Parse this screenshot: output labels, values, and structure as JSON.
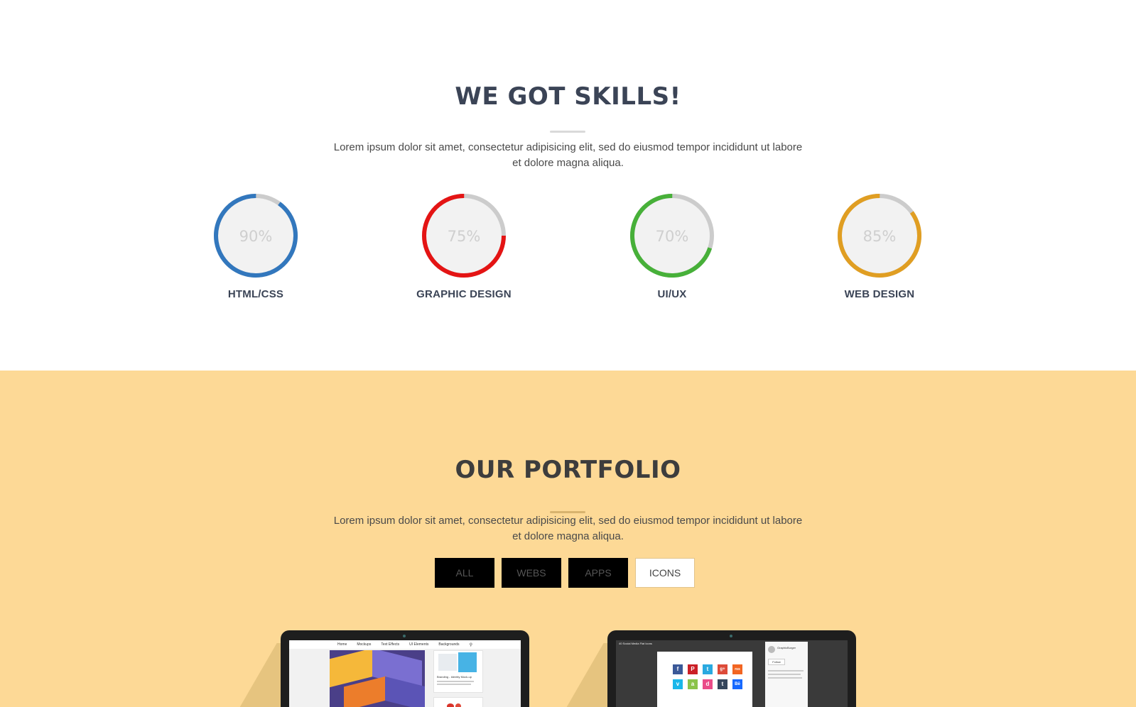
{
  "skills": {
    "title": "WE GOT SKILLS!",
    "subtitle": "Lorem ipsum dolor sit amet, consectetur adipisicing elit, sed do eiusmod tempor incididunt ut labore et dolore magna aliqua.",
    "items": [
      {
        "label": "HTML/CSS",
        "percent": 90,
        "percent_text": "90%",
        "color": "#3277bd"
      },
      {
        "label": "GRAPHIC DESIGN",
        "percent": 75,
        "percent_text": "75%",
        "color": "#e41414"
      },
      {
        "label": "UI/UX",
        "percent": 70,
        "percent_text": "70%",
        "color": "#47b039"
      },
      {
        "label": "WEB DESIGN",
        "percent": 85,
        "percent_text": "85%",
        "color": "#e09e22"
      }
    ],
    "track_color": "#cccccc"
  },
  "portfolio": {
    "title": "OUR PORTFOLIO",
    "subtitle": "Lorem ipsum dolor sit amet, consectetur adipisicing elit, sed do eiusmod tempor incididunt ut labore et dolore magna aliqua.",
    "filters": [
      {
        "label": "ALL",
        "active": false
      },
      {
        "label": "WEBS",
        "active": false
      },
      {
        "label": "APPS",
        "active": false
      },
      {
        "label": "ICONS",
        "active": true
      }
    ],
    "items": [
      {
        "nav": [
          "Home",
          "Mockups",
          "Text Effects",
          "UI Elements",
          "Backgrounds"
        ],
        "post_title": "Branding - Identity Mock-up"
      },
      {
        "post_title": "40 Social Media Flat Icons",
        "profile_name": "GraphicBurger",
        "follow_label": "Follow",
        "icons": [
          "f",
          "P",
          "t",
          "g+",
          "rss",
          "v",
          "a",
          "d",
          "t",
          "Bē"
        ]
      }
    ],
    "background": "#fdd996"
  }
}
